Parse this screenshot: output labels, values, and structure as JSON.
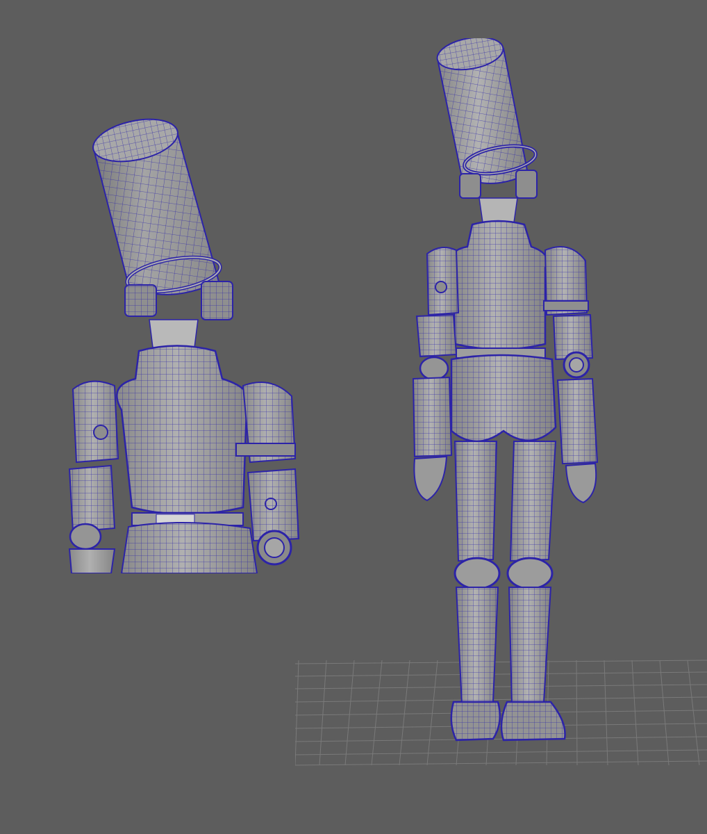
{
  "viewport": {
    "background": "#5d5d5d",
    "mesh_fill": "#9a9a9a",
    "mesh_light": "#b4b4b4",
    "mesh_dark": "#7c7c7c",
    "wire_color": "#2c23a8",
    "grid_color": "#7a7a7a"
  },
  "views": [
    {
      "id": "closeup",
      "icon": "character-back-closeup"
    },
    {
      "id": "full",
      "icon": "character-back-full-body"
    }
  ]
}
